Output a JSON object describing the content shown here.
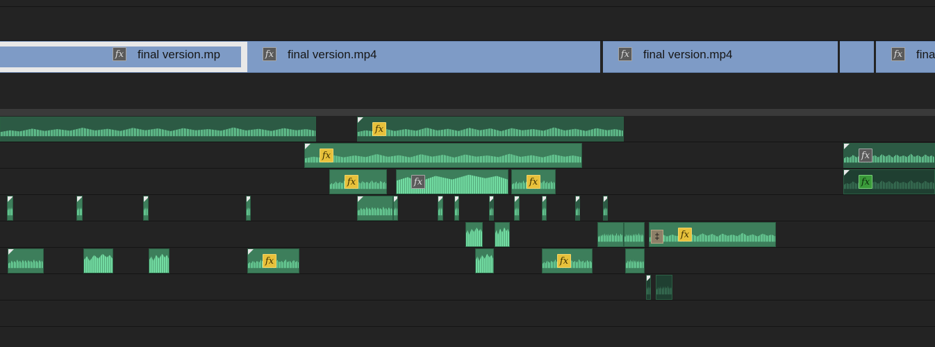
{
  "video_track": {
    "clips": [
      {
        "label": "final version.mp",
        "selected": true
      },
      {
        "label": "final version.mp4"
      },
      {
        "label": "final version.mp4"
      },
      {
        "label": ""
      },
      {
        "label": "fina"
      }
    ]
  },
  "fx_badge": "fx",
  "transition_icon": "‡",
  "colors": {
    "video_clip": "#7e9bc6",
    "audio_clip": "#3d7e5b",
    "waveform": "#73e1a5",
    "fx_badge_active": "#e7c13b",
    "fx_badge_inactive": "#5a5a5a",
    "background": "#232323"
  }
}
